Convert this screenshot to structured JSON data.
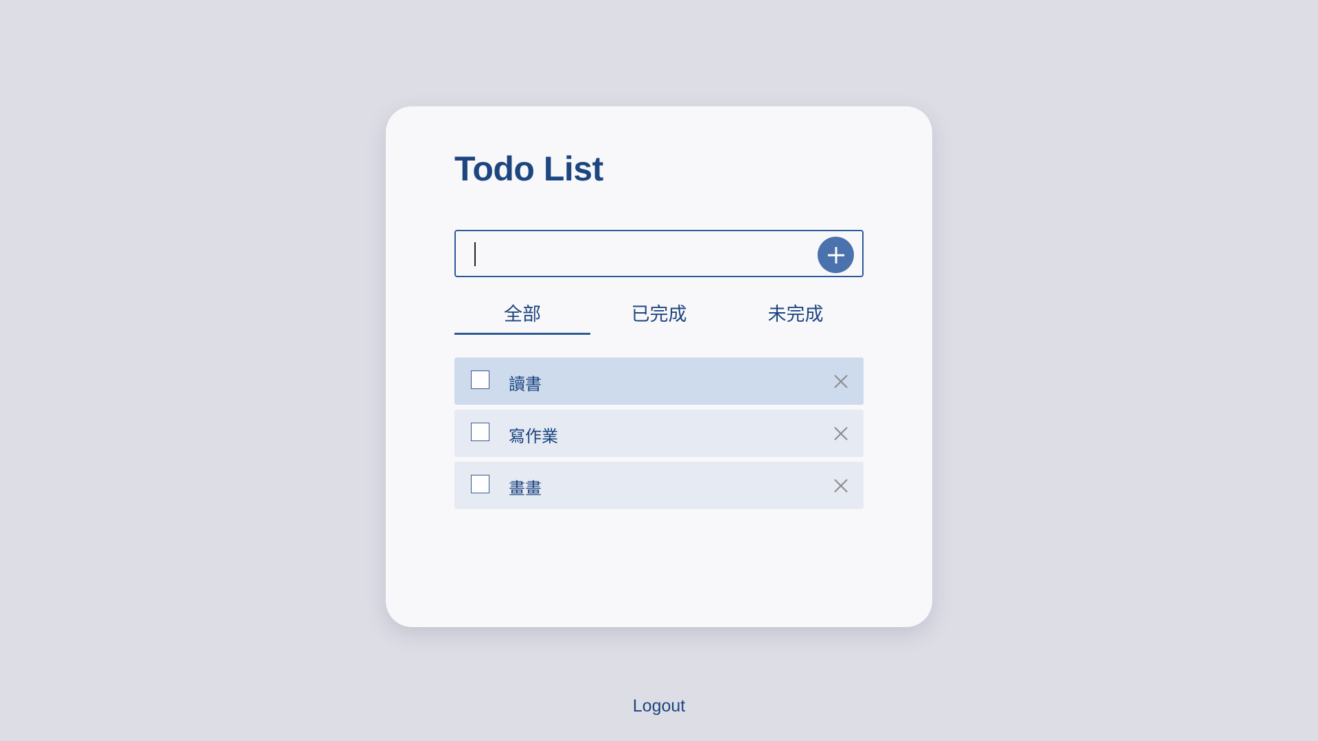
{
  "app": {
    "title": "Todo List"
  },
  "input": {
    "value": "",
    "placeholder": ""
  },
  "add_button": {
    "icon": "plus-icon"
  },
  "tabs": [
    {
      "label": "全部",
      "active": true
    },
    {
      "label": "已完成",
      "active": false
    },
    {
      "label": "未完成",
      "active": false
    }
  ],
  "todos": [
    {
      "text": "讀書",
      "done": false
    },
    {
      "text": "寫作業",
      "done": false
    },
    {
      "text": "畫畫",
      "done": false
    }
  ],
  "footer": {
    "logout_label": "Logout"
  },
  "colors": {
    "page_background": "#dcdde5",
    "card_background": "#f8f8fa",
    "accent": "#1d4580",
    "button": "#4a72ad",
    "item_highlight": "#cddbec",
    "item_background": "#e5eaf3"
  }
}
